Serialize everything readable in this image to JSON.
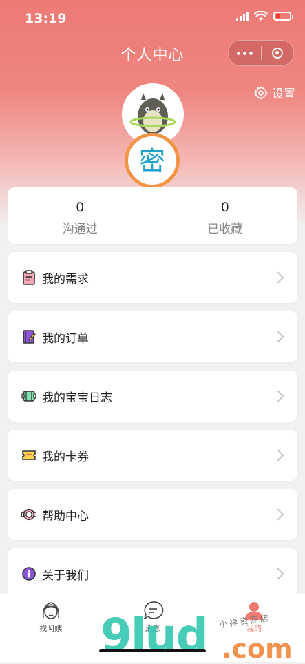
{
  "status": {
    "time": "13:19"
  },
  "nav": {
    "title": "个人中心"
  },
  "settings": {
    "label": "设置"
  },
  "avatar": {
    "badge_char": "密"
  },
  "stats": [
    {
      "value": "0",
      "label": "沟通过"
    },
    {
      "value": "0",
      "label": "已收藏"
    }
  ],
  "menu": [
    {
      "label": "我的需求",
      "icon": "clipboard-icon"
    },
    {
      "label": "我的订单",
      "icon": "order-notebook-icon"
    },
    {
      "label": "我的宝宝日志",
      "icon": "baby-log-icon"
    },
    {
      "label": "我的卡券",
      "icon": "coupon-icon"
    },
    {
      "label": "帮助中心",
      "icon": "help-headset-icon"
    },
    {
      "label": "关于我们",
      "icon": "info-icon"
    }
  ],
  "tabs": [
    {
      "label": "找阿姨",
      "icon": "nanny-face-icon"
    },
    {
      "label": "消息",
      "icon": "chat-bubble-icon"
    },
    {
      "label": "我的",
      "icon": "user-icon"
    }
  ],
  "watermark": {
    "main": "9lud",
    "sub": ".com",
    "small": "小祥资商店"
  },
  "colors": {
    "header": "#ee7a74",
    "accent": "#ef7a72",
    "badge_ring": "#f29445"
  }
}
